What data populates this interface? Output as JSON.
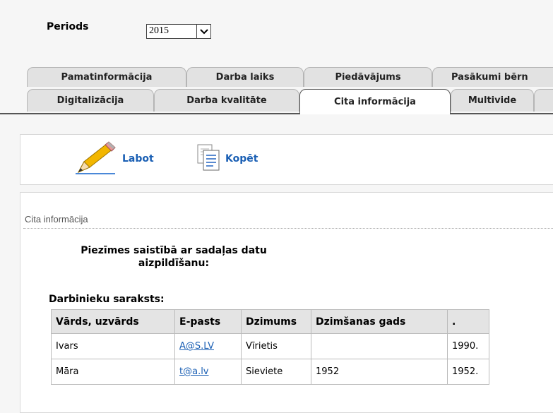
{
  "period": {
    "label": "Periods",
    "selected": "2015"
  },
  "tabs_row1": [
    {
      "label": "Pamatinformācija"
    },
    {
      "label": "Darba laiks"
    },
    {
      "label": "Piedāvājums"
    },
    {
      "label": "Pasākumi bērn"
    }
  ],
  "tabs_row2": [
    {
      "label": "Digitalizācija"
    },
    {
      "label": "Darba kvalitāte"
    },
    {
      "label": "Cita informācija"
    },
    {
      "label": "Multivide"
    }
  ],
  "toolbar": {
    "edit_label": "Labot",
    "copy_label": "Kopēt"
  },
  "section": {
    "title": "Cita informācija",
    "notes_label": "Piezīmes saistībā ar sadaļas datu aizpildīšanu:",
    "staff_label": "Darbinieku saraksts:"
  },
  "staff_table": {
    "headers": [
      "Vārds, uzvārds",
      "E-pasts",
      "Dzimums",
      "Dzimšanas gads",
      "."
    ],
    "rows": [
      {
        "name": "Ivars",
        "email": "A@S.LV",
        "gender": "Vīrietis",
        "birth_year": "",
        "dot": "1990."
      },
      {
        "name": "Māra",
        "email": "t@a.lv",
        "gender": "Sieviete",
        "birth_year": "1952",
        "dot": "1952."
      }
    ]
  },
  "colors": {
    "link": "#1a5fb4",
    "active_tab": "#ffffff",
    "inactive_tab": "#e2e2e2"
  }
}
